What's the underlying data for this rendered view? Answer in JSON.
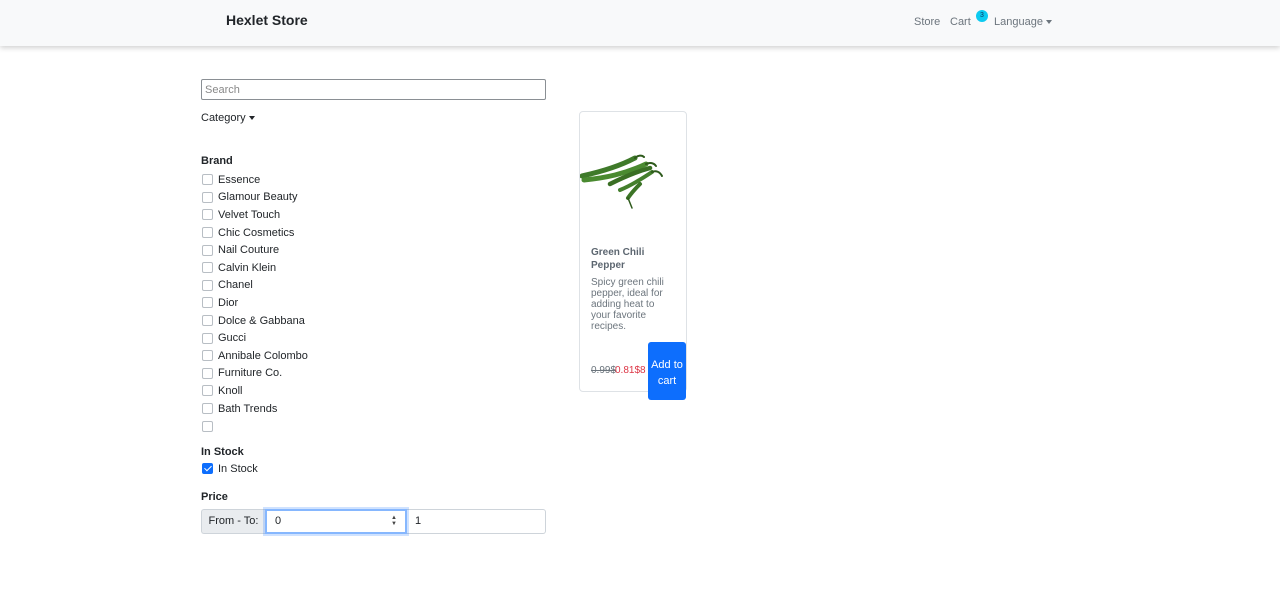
{
  "navbar": {
    "brand": "Hexlet Store",
    "store": "Store",
    "cart": "Cart",
    "cart_count": "3",
    "language": "Language"
  },
  "filters": {
    "search_placeholder": "Search",
    "category_label": "Category",
    "brand_title": "Brand",
    "brands": [
      {
        "label": "Essence",
        "checked": false
      },
      {
        "label": "Glamour Beauty",
        "checked": false
      },
      {
        "label": "Velvet Touch",
        "checked": false
      },
      {
        "label": "Chic Cosmetics",
        "checked": false
      },
      {
        "label": "Nail Couture",
        "checked": false
      },
      {
        "label": "Calvin Klein",
        "checked": false
      },
      {
        "label": "Chanel",
        "checked": false
      },
      {
        "label": "Dior",
        "checked": false
      },
      {
        "label": "Dolce & Gabbana",
        "checked": false
      },
      {
        "label": "Gucci",
        "checked": false
      },
      {
        "label": "Annibale Colombo",
        "checked": false
      },
      {
        "label": "Furniture Co.",
        "checked": false
      },
      {
        "label": "Knoll",
        "checked": false
      },
      {
        "label": "Bath Trends",
        "checked": false
      },
      {
        "label": "",
        "checked": false
      }
    ],
    "stock_title": "In Stock",
    "stock_label": "In Stock",
    "stock_checked": true,
    "price_title": "Price",
    "price_label": "From - To:",
    "price_from": "0",
    "price_to": "1"
  },
  "product": {
    "title": "Green Chili Pepper",
    "description": "Spicy green chili pepper, ideal for adding heat to your favorite recipes.",
    "old_price": "0.99$",
    "new_price": "0.81$",
    "price_suffix": "8",
    "button": "Add to cart",
    "image": "green-chili-pepper"
  },
  "colors": {
    "primary": "#0d6efd",
    "badge": "#0dcaf0",
    "sale": "#dc3545",
    "navbar_bg": "#f8f9fa"
  }
}
